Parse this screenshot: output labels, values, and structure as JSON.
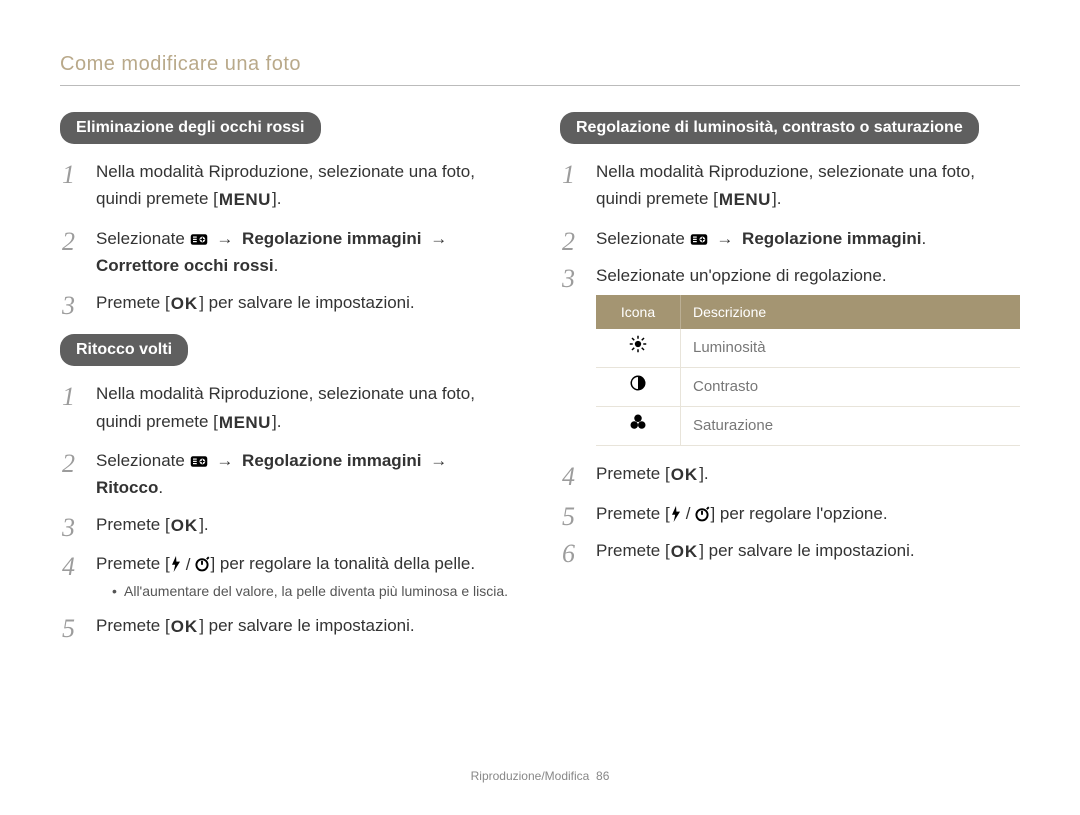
{
  "page_header": "Come modificare una foto",
  "footer": {
    "section": "Riproduzione/Modifica",
    "page": "86"
  },
  "kbd": {
    "menu": "MENU",
    "ok": "OK"
  },
  "common": {
    "step_play_select_photo_a": "Nella modalità Riproduzione, selezionate una foto, quindi premete [",
    "step_play_select_photo_b": "].",
    "select_prefix": "Selezionate ",
    "arrow": "→",
    "regolazione_immagini": "Regolazione immagini",
    "press_prefix": "Premete [",
    "press_suffix_save": "] per salvare le impostazioni.",
    "press_suffix_plain": "].",
    "press_adjust_suffix": "] per regolare l'opzione.",
    "press_adjust_skin": "] per regolare la tonalità della pelle."
  },
  "left": {
    "section1_title": "Eliminazione degli occhi rossi",
    "section1_step2_tail": "Correttore occhi rossi",
    "section2_title": "Ritocco volti",
    "section2_step2_tail": "Ritocco",
    "section2_step4_note": "All'aumentare del valore, la pelle diventa più luminosa e liscia."
  },
  "right": {
    "section_title": "Regolazione di luminosità, contrasto o saturazione",
    "step3": "Selezionate un'opzione di regolazione.",
    "table": {
      "head_icon": "Icona",
      "head_desc": "Descrizione",
      "rows": [
        {
          "icon": "brightness",
          "label": "Luminosità"
        },
        {
          "icon": "contrast",
          "label": "Contrasto"
        },
        {
          "icon": "saturation",
          "label": "Saturazione"
        }
      ]
    }
  }
}
